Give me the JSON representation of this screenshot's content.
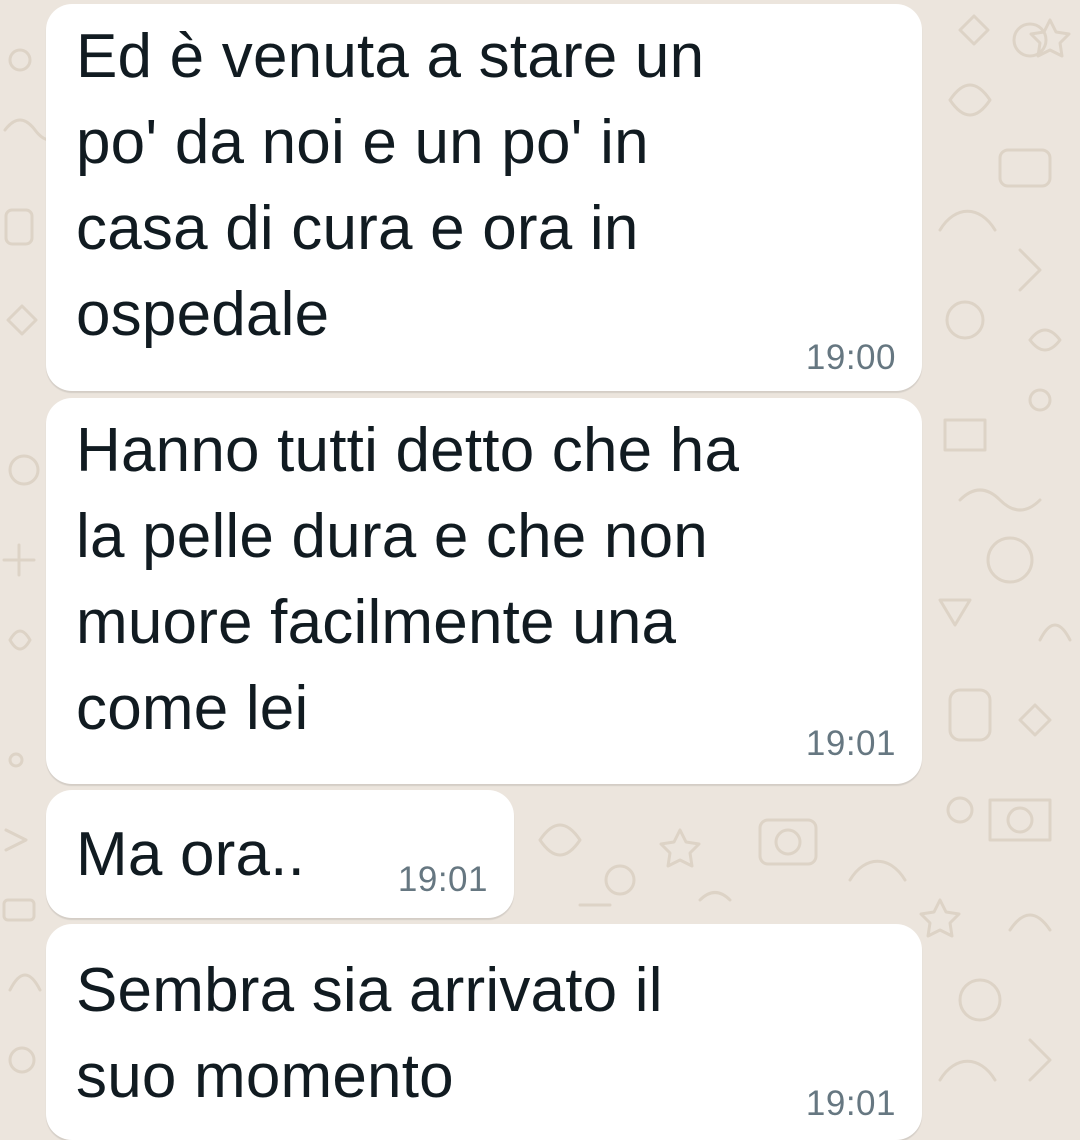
{
  "chat": {
    "messages": [
      {
        "text": "Ed è venuta a stare un\npo' da noi e un po' in\ncasa di cura e ora in\nospedale",
        "time": "19:00"
      },
      {
        "text": "Hanno tutti detto che ha\nla pelle dura e che non\nmuore facilmente una\ncome lei",
        "time": "19:01"
      },
      {
        "text": "Ma ora..",
        "time": "19:01"
      },
      {
        "text": "Sembra sia arrivato il\nsuo momento",
        "time": "19:01"
      }
    ]
  },
  "theme": {
    "wallpaper_color": "#ece5dd",
    "bubble_color": "#ffffff",
    "text_color": "#111b21",
    "time_color": "#667781"
  }
}
